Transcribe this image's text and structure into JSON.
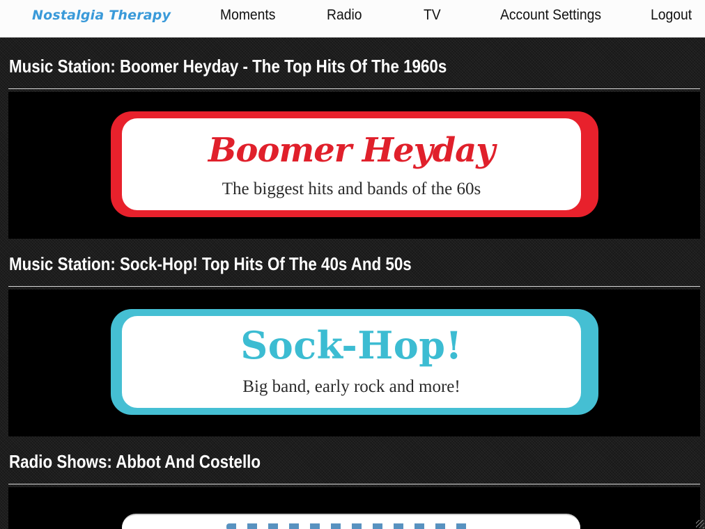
{
  "brand": {
    "name": "Nostalgia Therapy",
    "color": "#3a9ad9"
  },
  "nav": {
    "items": [
      "Moments",
      "Radio",
      "TV",
      "Account Settings",
      "Logout"
    ]
  },
  "sections": [
    {
      "title": "Music Station: Boomer Heyday - The Top Hits Of The 1960s",
      "card": {
        "logo": "Boomer Heyday",
        "tagline": "The biggest hits and bands of the 60s",
        "border_color": "#e8212c"
      }
    },
    {
      "title": "Music Station: Sock-Hop! Top Hits Of The 40s And 50s",
      "card": {
        "logo": "Sock-Hop!",
        "tagline": "Big band, early rock and more!",
        "border_color": "#45bfd3"
      }
    },
    {
      "title": "Radio Shows: Abbot And Costello"
    }
  ]
}
